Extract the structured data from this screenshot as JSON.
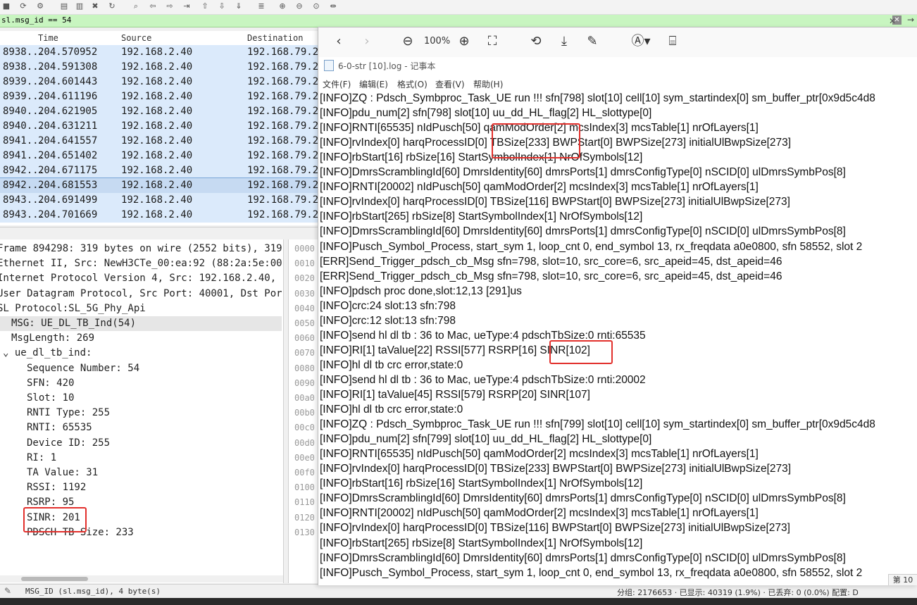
{
  "filter": {
    "text": "sl.msg_id == 54"
  },
  "packet_list": {
    "columns": [
      "Time",
      "Source",
      "Destination"
    ],
    "rows": [
      {
        "no": "8938...",
        "time": "204.570952",
        "src": "192.168.2.40",
        "dst": "192.168.79.2"
      },
      {
        "no": "8938...",
        "time": "204.591308",
        "src": "192.168.2.40",
        "dst": "192.168.79.2"
      },
      {
        "no": "8939...",
        "time": "204.601443",
        "src": "192.168.2.40",
        "dst": "192.168.79.2"
      },
      {
        "no": "8939...",
        "time": "204.611196",
        "src": "192.168.2.40",
        "dst": "192.168.79.2"
      },
      {
        "no": "8940...",
        "time": "204.621905",
        "src": "192.168.2.40",
        "dst": "192.168.79.2"
      },
      {
        "no": "8940...",
        "time": "204.631211",
        "src": "192.168.2.40",
        "dst": "192.168.79.2"
      },
      {
        "no": "8941...",
        "time": "204.641557",
        "src": "192.168.2.40",
        "dst": "192.168.79.2"
      },
      {
        "no": "8941...",
        "time": "204.651402",
        "src": "192.168.2.40",
        "dst": "192.168.79.2"
      },
      {
        "no": "8942...",
        "time": "204.671175",
        "src": "192.168.2.40",
        "dst": "192.168.79.2"
      },
      {
        "no": "8942...",
        "time": "204.681553",
        "src": "192.168.2.40",
        "dst": "192.168.79.2",
        "selected": true
      },
      {
        "no": "8943...",
        "time": "204.691499",
        "src": "192.168.2.40",
        "dst": "192.168.79.2"
      },
      {
        "no": "8943...",
        "time": "204.701669",
        "src": "192.168.2.40",
        "dst": "192.168.79.2"
      }
    ]
  },
  "details": [
    {
      "text": "Frame 894298: 319 bytes on wire (2552 bits), 319"
    },
    {
      "text": "Ethernet II, Src: NewH3CTe_00:ea:92 (88:2a:5e:00"
    },
    {
      "text": "Internet Protocol Version 4, Src: 192.168.2.40,"
    },
    {
      "text": "User Datagram Protocol, Src Port: 40001, Dst Por"
    },
    {
      "text": "SL Protocol:SL_5G_Phy_Api"
    },
    {
      "text": "MSG: UE_DL_TB_Ind(54)"
    },
    {
      "text": "MsgLength: 269"
    },
    {
      "text": "ue_dl_tb_ind:"
    },
    {
      "text": "Sequence Number: 54"
    },
    {
      "text": "SFN: 420"
    },
    {
      "text": "Slot: 10"
    },
    {
      "text": "RNTI Type: 255"
    },
    {
      "text": "RNTI: 65535"
    },
    {
      "text": "Device ID: 255"
    },
    {
      "text": "RI: 1"
    },
    {
      "text": "TA Value: 31"
    },
    {
      "text": "RSSI: 1192"
    },
    {
      "text": "RSRP: 95"
    },
    {
      "text": "SINR: 201"
    },
    {
      "text": "PDSCH TB Size: 233"
    }
  ],
  "hex_offsets": [
    "0000",
    "0010",
    "0020",
    "0030",
    "0040",
    "0050",
    "0060",
    "0070",
    "0080",
    "0090",
    "00a0",
    "00b0",
    "00c0",
    "00d0",
    "00e0",
    "00f0",
    "0100",
    "0110",
    "0120",
    "0130"
  ],
  "status": {
    "left": "MSG_ID (sl.msg_id), 4 byte(s)",
    "right": "分组: 2176653 · 已显示: 40319 (1.9%) · 已丢弃: 0 (0.0%)   配置: D"
  },
  "viewer": {
    "zoom": "100%",
    "window_title": "6-0-str [10].log - 记事本",
    "menus": [
      "文件(F)",
      "编辑(E)",
      "格式(O)",
      "查看(V)",
      "帮助(H)"
    ],
    "page_hint": "第 10",
    "lines": [
      "[INFO]ZQ : Pdsch_Symbproc_Task_UE run !!! sfn[798] slot[10] cell[10] sym_startindex[0] sm_buffer_ptr[0x9d5c4d8",
      "[INFO]pdu_num[2] sfn[798] slot[10] uu_dd_HL_flag[2] HL_slottype[0]",
      "[INFO]RNTI[65535] nIdPusch[50] qamModOrder[2] mcsIndex[3] mcsTable[1] nrOfLayers[1]",
      "[INFO]rvIndex[0] harqProcessID[0] TBSize[233] BWPStart[0] BWPSize[273] initialUlBwpSize[273]",
      "[INFO]rbStart[16] rbSize[16] StartSymbolIndex[1] NrOfSymbols[12]",
      "[INFO]DmrsScramblingId[60] DmrsIdentity[60] dmrsPorts[1] dmrsConfigType[0] nSCID[0] ulDmrsSymbPos[8]",
      "[INFO]RNTI[20002] nIdPusch[50] qamModOrder[2] mcsIndex[3] mcsTable[1] nrOfLayers[1]",
      "[INFO]rvIndex[0] harqProcessID[0] TBSize[116] BWPStart[0] BWPSize[273] initialUlBwpSize[273]",
      "[INFO]rbStart[265] rbSize[8] StartSymbolIndex[1] NrOfSymbols[12]",
      "[INFO]DmrsScramblingId[60] DmrsIdentity[60] dmrsPorts[1] dmrsConfigType[0] nSCID[0] ulDmrsSymbPos[8]",
      "[INFO]Pusch_Symbol_Process, start_sym 1, loop_cnt 0, end_symbol 13, rx_freqdata a0e0800, sfn 58552, slot 2",
      "[ERR]Send_Trigger_pdsch_cb_Msg sfn=798, slot=10, src_core=6, src_apeid=45, dst_apeid=46",
      "[ERR]Send_Trigger_pdsch_cb_Msg sfn=798, slot=10, src_core=6, src_apeid=45, dst_apeid=46",
      "[INFO]pdsch proc done,slot:12,13 [291]us",
      "[INFO]crc:24 slot:13 sfn:798",
      "[INFO]crc:12 slot:13 sfn:798",
      "[INFO]send hl dl tb : 36 to Mac, ueType:4 pdschTbSize:0 rnti:65535",
      "[INFO]RI[1] taValue[22] RSSI[577] RSRP[16] SINR[102]",
      "[INFO]hl dl tb crc error,state:0",
      "[INFO]send hl dl tb : 36 to Mac, ueType:4 pdschTbSize:0 rnti:20002",
      "[INFO]RI[1] taValue[45] RSSI[579] RSRP[20] SINR[107]",
      "[INFO]hl dl tb crc error,state:0",
      "[INFO]ZQ : Pdsch_Symbproc_Task_UE run !!! sfn[799] slot[10] cell[10] sym_startindex[0] sm_buffer_ptr[0x9d5c4d8",
      "[INFO]pdu_num[2] sfn[799] slot[10] uu_dd_HL_flag[2] HL_slottype[0]",
      "[INFO]RNTI[65535] nIdPusch[50] qamModOrder[2] mcsIndex[3] mcsTable[1] nrOfLayers[1]",
      "[INFO]rvIndex[0] harqProcessID[0] TBSize[233] BWPStart[0] BWPSize[273] initialUlBwpSize[273]",
      "[INFO]rbStart[16] rbSize[16] StartSymbolIndex[1] NrOfSymbols[12]",
      "[INFO]DmrsScramblingId[60] DmrsIdentity[60] dmrsPorts[1] dmrsConfigType[0] nSCID[0] ulDmrsSymbPos[8]",
      "[INFO]RNTI[20002] nIdPusch[50] qamModOrder[2] mcsIndex[3] mcsTable[1] nrOfLayers[1]",
      "[INFO]rvIndex[0] harqProcessID[0] TBSize[116] BWPStart[0] BWPSize[273] initialUlBwpSize[273]",
      "[INFO]rbStart[265] rbSize[8] StartSymbolIndex[1] NrOfSymbols[12]",
      "[INFO]DmrsScramblingId[60] DmrsIdentity[60] dmrsPorts[1] dmrsConfigType[0] nSCID[0] ulDmrsSymbPos[8]",
      "[INFO]Pusch_Symbol_Process, start_sym 1, loop_cnt 0, end_symbol 13, rx_freqdata a0e0800, sfn 58552, slot 2"
    ]
  },
  "colors": {
    "highlight": "#e2302c",
    "filter_bg": "#c8f5c0",
    "row_bg": "#dbeafb"
  }
}
